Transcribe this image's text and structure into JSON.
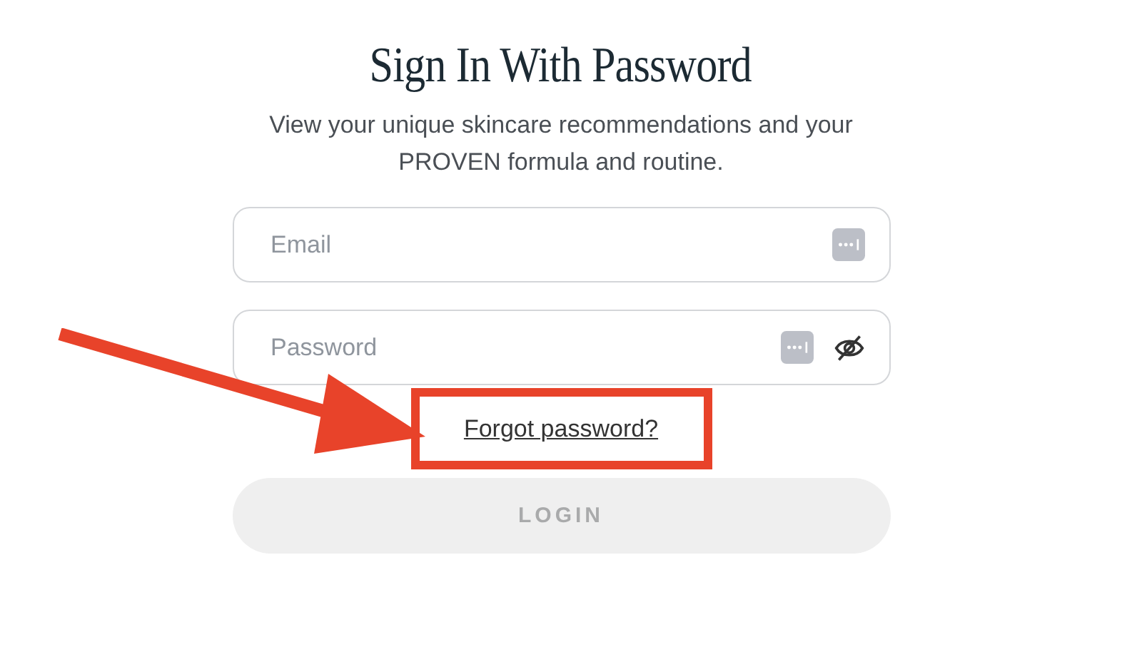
{
  "title": "Sign In With Password",
  "subtitle": "View your unique skincare recommendations and your PROVEN formula and routine.",
  "fields": [
    {
      "kind": "email",
      "placeholder": "Email"
    },
    {
      "kind": "password",
      "placeholder": "Password"
    }
  ],
  "forgot_link": "Forgot password?",
  "login_button": {
    "label": "LOGIN",
    "disabled": true
  }
}
